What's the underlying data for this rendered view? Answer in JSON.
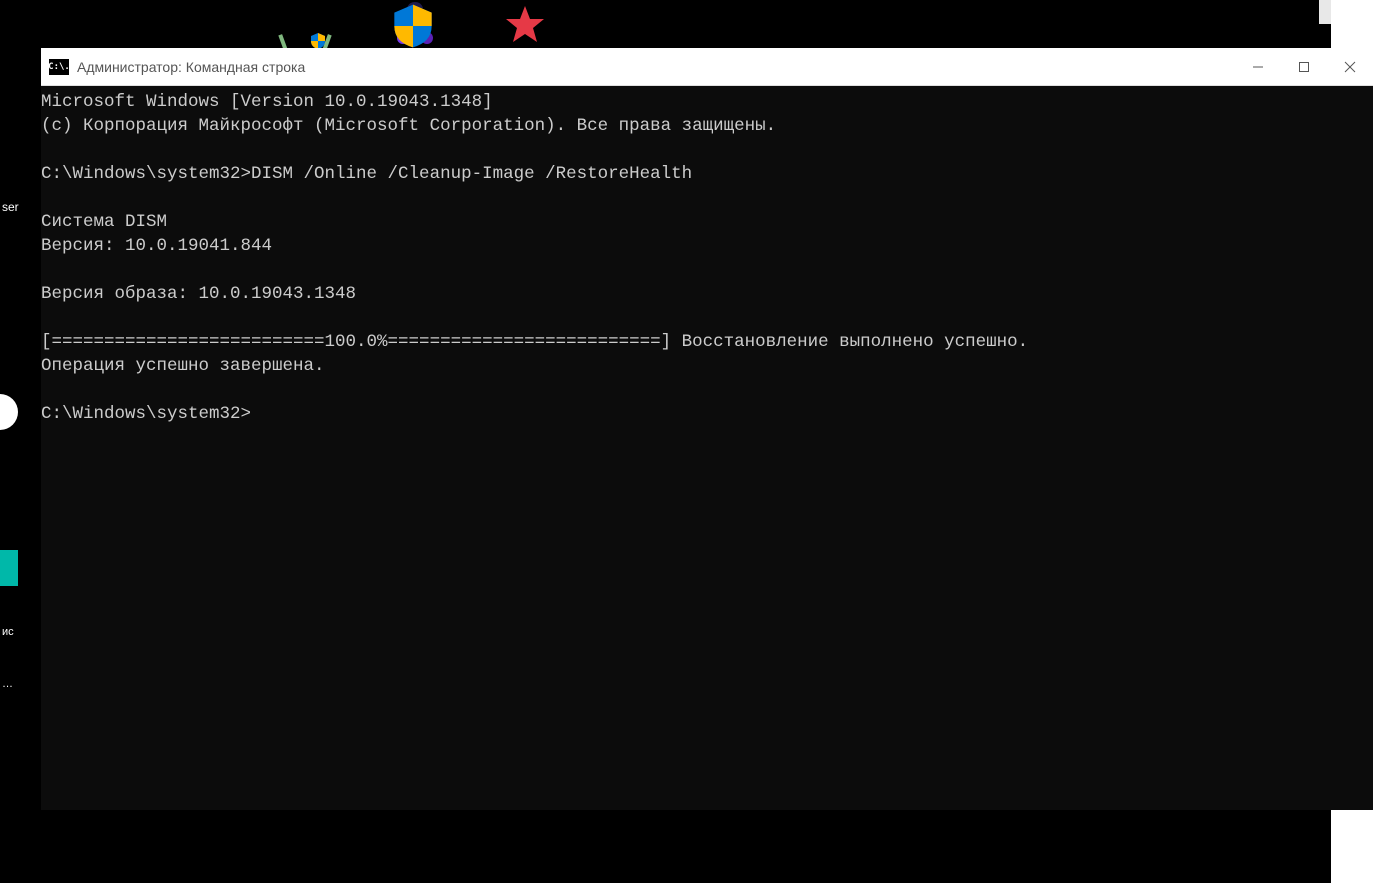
{
  "desktop": {
    "left_fragments": {
      "ser": "ser",
      "ic": "ис",
      "dots": "…"
    },
    "top_icons": [
      "game1",
      "wizard",
      "starcraft"
    ]
  },
  "window": {
    "icon_label": "C:\\.",
    "title": "Администратор: Командная строка"
  },
  "terminal": {
    "lines": [
      "Microsoft Windows [Version 10.0.19043.1348]",
      "(c) Корпорация Майкрософт (Microsoft Corporation). Все права защищены.",
      "",
      "C:\\Windows\\system32>DISM /Online /Cleanup-Image /RestoreHealth",
      "",
      "Cистема DISM",
      "Версия: 10.0.19041.844",
      "",
      "Версия образа: 10.0.19043.1348",
      "",
      "[==========================100.0%==========================] Восстановление выполнено успешно.",
      "Операция успешно завершена.",
      "",
      "C:\\Windows\\system32>"
    ]
  }
}
